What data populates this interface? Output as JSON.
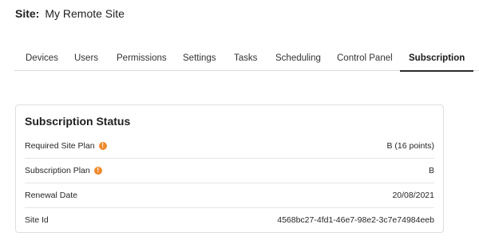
{
  "site": {
    "label": "Site:",
    "name": "My Remote Site"
  },
  "tabs": [
    {
      "label": "Devices"
    },
    {
      "label": "Users"
    },
    {
      "label": "Permissions"
    },
    {
      "label": "Settings"
    },
    {
      "label": "Tasks"
    },
    {
      "label": "Scheduling"
    },
    {
      "label": "Control Panel"
    },
    {
      "label": "Subscription",
      "active": true
    }
  ],
  "subscription": {
    "title": "Subscription Status",
    "rows": [
      {
        "label": "Required Site Plan",
        "value": "B (16 points)",
        "info_icon": "info-icon"
      },
      {
        "label": "Subscription Plan",
        "value": "B",
        "info_icon": "info-icon"
      },
      {
        "label": "Renewal Date",
        "value": "20/08/2021"
      },
      {
        "label": "Site Id",
        "value": "4568bc27-4fd1-46e7-98e2-3c7e74984eeb"
      }
    ]
  },
  "colors": {
    "info_icon": "#f08a2c",
    "active_tab_underline": "#2b2b2b",
    "divider": "#dcdcdc"
  }
}
